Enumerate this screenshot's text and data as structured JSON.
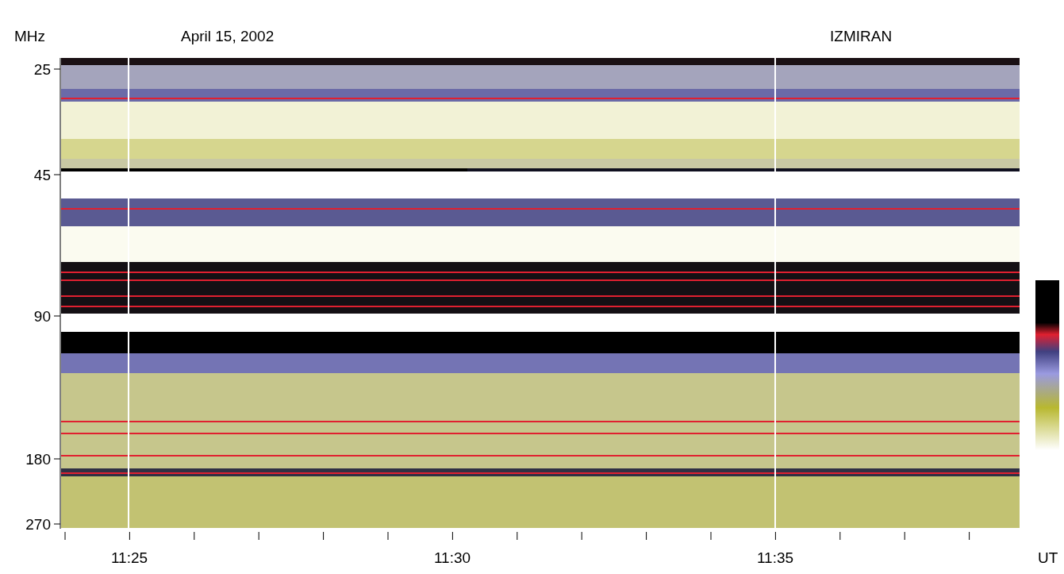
{
  "header": {
    "unit": "MHz",
    "date": "April 15, 2002",
    "observatory": "IZMIRAN"
  },
  "y_axis": {
    "labels": [
      "25",
      "45",
      "90",
      "180",
      "270"
    ]
  },
  "x_axis": {
    "labels": [
      "11:25",
      "11:30",
      "11:35"
    ],
    "unit": "UT"
  }
}
